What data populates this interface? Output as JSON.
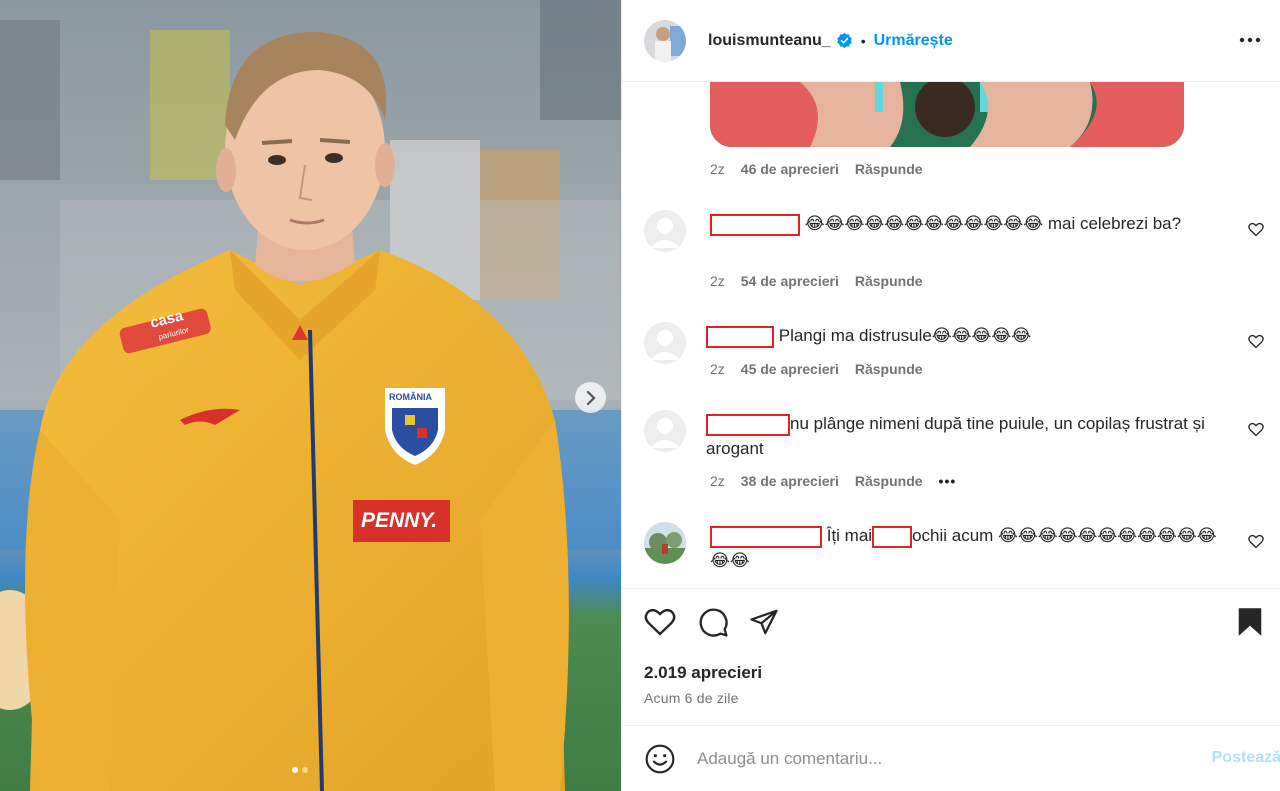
{
  "post": {
    "username": "louismunteanu_",
    "separator": "•",
    "follow_label": "Urmărește",
    "image_count": 2,
    "active_image": 1
  },
  "photo": {
    "sponsor_1": "casa",
    "sponsor_1_sub": "pariurilor",
    "crest_text": "ROMÂNIA",
    "sponsor_2": "PENNY."
  },
  "comments": [
    {
      "type": "image-reply",
      "time": "2z",
      "likes": "46 de aprecieri",
      "reply": "Răspunde"
    },
    {
      "text_after": "😂😂😂😂😂😂😂😂😂😂😂😂 mai celebrezi ba?",
      "time": "2z",
      "likes": "54 de aprecieri",
      "reply": "Răspunde"
    },
    {
      "text_after": "Plangi ma distrusule😂😂😂😂😂",
      "time": "2z",
      "likes": "45 de aprecieri",
      "reply": "Răspunde"
    },
    {
      "text_after": "nu plânge nimeni după tine puiule, un copilaș frustrat și arogant",
      "time": "2z",
      "likes": "38 de aprecieri",
      "reply": "Răspunde",
      "more": "•••"
    },
    {
      "text_a": "Îți mai",
      "text_b": "ochii acum 😂😂😂😂😂😂😂😂😂😂😂😂😂"
    }
  ],
  "stats": {
    "likes": "2.019 aprecieri",
    "time_ago": "Acum 6 de zile"
  },
  "composer": {
    "placeholder": "Adaugă un comentariu...",
    "post_label": "Postează"
  },
  "colors": {
    "accent": "#0095f6",
    "redaction": "#e02424",
    "jersey": "#f0b232"
  }
}
